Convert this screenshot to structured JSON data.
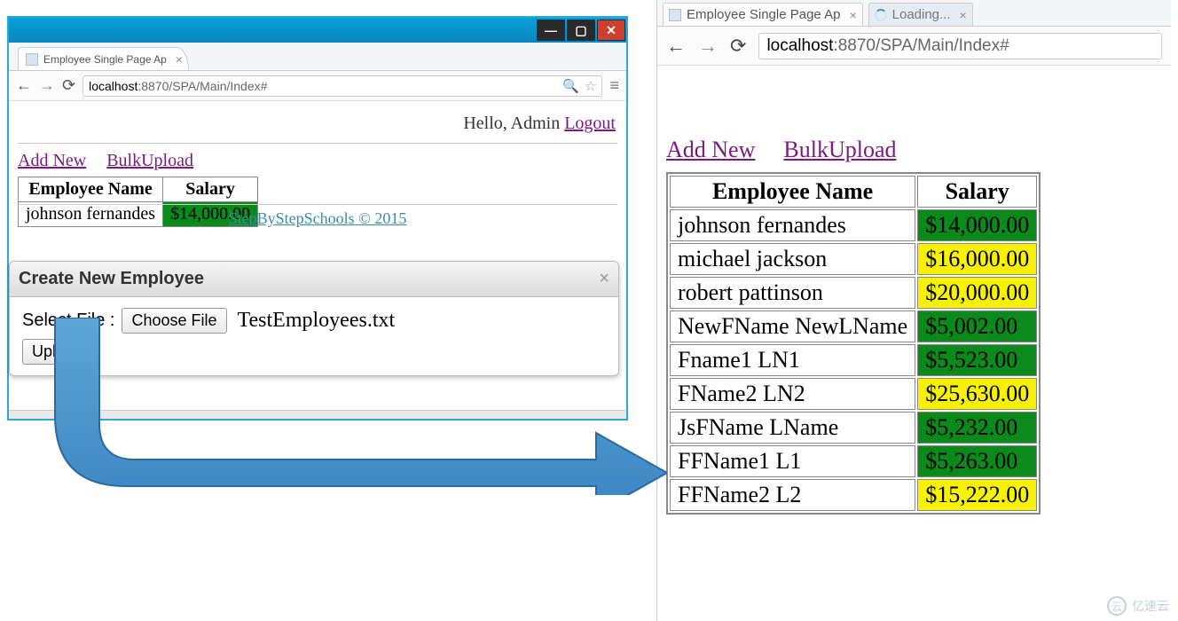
{
  "left": {
    "tab_title": "Employee Single Page Ap",
    "url_host": "localhost",
    "url_path": ":8870/SPA/Main/Index#",
    "hello_text": "Hello, Admin ",
    "logout_label": "Logout",
    "link_addnew": "Add New",
    "link_bulk": "BulkUpload",
    "table": {
      "col_name": "Employee Name",
      "col_salary": "Salary",
      "rows": [
        {
          "name": "johnson fernandes",
          "salary": "$14,000.00",
          "color": "green"
        }
      ]
    },
    "dialog": {
      "title": "Create New Employee",
      "select_file_label": "Select File :",
      "choose_file_btn": "Choose File",
      "filename": "TestEmployees.txt",
      "upload_btn": "Upload"
    },
    "footer": "StepByStepSchools © 2015",
    "titlebar": {
      "min": "—",
      "max": "▢",
      "close": "✕"
    }
  },
  "right": {
    "tab_title": "Employee Single Page Ap",
    "tab2_title": "Loading...",
    "url_host": "localhost",
    "url_path": ":8870/SPA/Main/Index#",
    "link_addnew": "Add New",
    "link_bulk": "BulkUpload",
    "table": {
      "col_name": "Employee Name",
      "col_salary": "Salary",
      "rows": [
        {
          "name": "johnson fernandes",
          "salary": "$14,000.00",
          "color": "green"
        },
        {
          "name": "michael jackson",
          "salary": "$16,000.00",
          "color": "yellow"
        },
        {
          "name": "robert pattinson",
          "salary": "$20,000.00",
          "color": "yellow"
        },
        {
          "name": "NewFName NewLName",
          "salary": "$5,002.00",
          "color": "green"
        },
        {
          "name": "Fname1 LN1",
          "salary": "$5,523.00",
          "color": "green"
        },
        {
          "name": "FName2 LN2",
          "salary": "$25,630.00",
          "color": "yellow"
        },
        {
          "name": "JsFName LName",
          "salary": "$5,232.00",
          "color": "green"
        },
        {
          "name": "FFName1 L1",
          "salary": "$5,263.00",
          "color": "green"
        },
        {
          "name": "FFName2 L2",
          "salary": "$15,222.00",
          "color": "yellow"
        }
      ]
    }
  },
  "watermark": "亿速云"
}
